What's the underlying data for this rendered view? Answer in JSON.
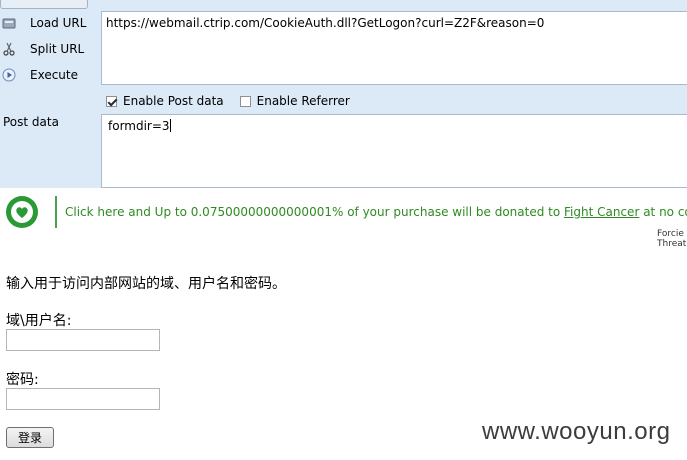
{
  "hackbar": {
    "load_url": "Load URL",
    "split_url": "Split URL",
    "execute": "Execute",
    "url_value": "https://webmail.ctrip.com/CookieAuth.dll?GetLogon?curl=Z2F&reason=0",
    "enable_post": "Enable Post data",
    "enable_post_checked": true,
    "enable_referrer": "Enable Referrer",
    "enable_referrer_checked": false,
    "post_label": "Post data",
    "post_value": "formdir=3"
  },
  "banner": {
    "text_before": "Click here and Up to 0.07500000000000001% of your purchase will be donated to ",
    "link": "Fight Cancer",
    "text_after": " at no cost to you",
    "corner_line1": "Forcie",
    "corner_line2": "Threat M",
    "accent": "#2a9a37"
  },
  "login": {
    "prompt": "输入用于访问内部网站的域、用户名和密码。",
    "user_label": "域\\用户名:",
    "pass_label": "密码:",
    "submit": "登录"
  },
  "watermark": "www.wooyun.org"
}
